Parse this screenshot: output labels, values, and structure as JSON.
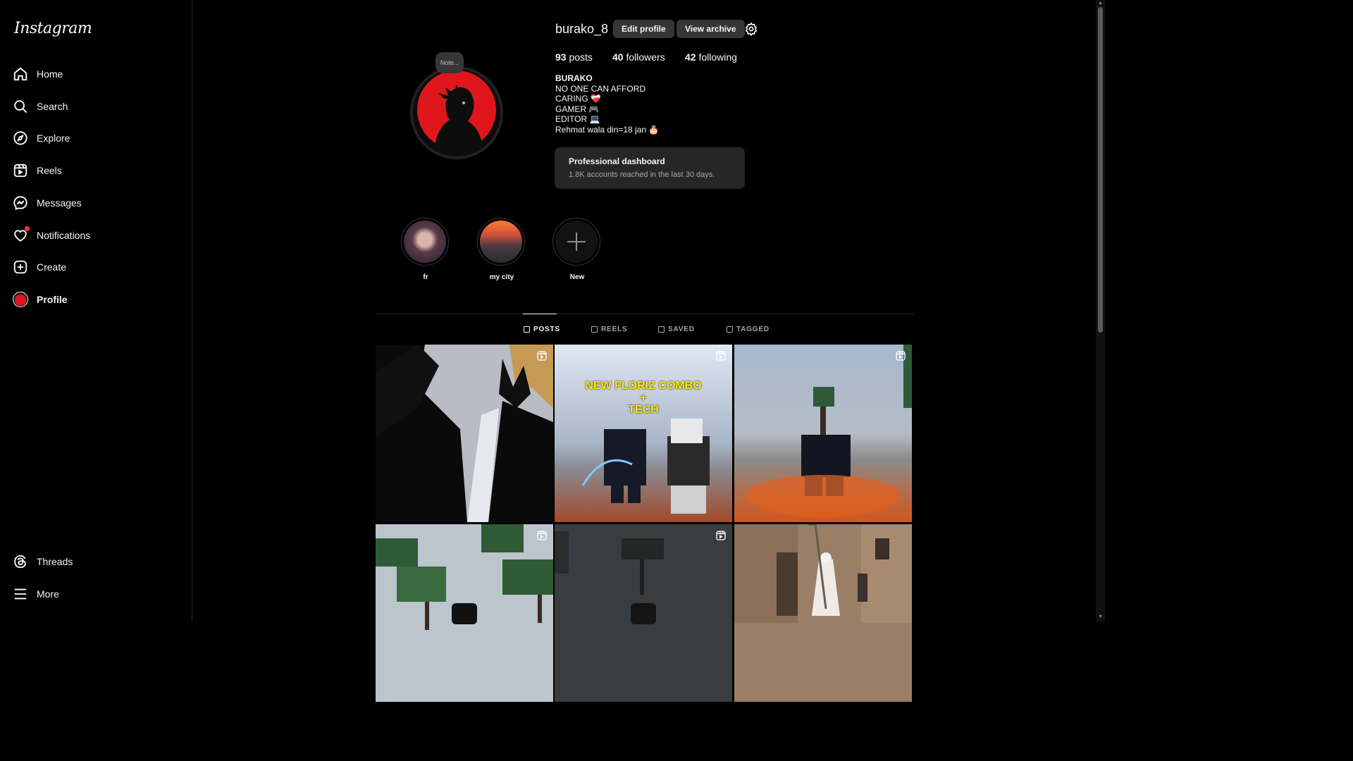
{
  "brand": {
    "logo_text": "Instagram"
  },
  "nav": {
    "items": [
      {
        "label": "Home",
        "icon": "home-icon"
      },
      {
        "label": "Search",
        "icon": "search-icon"
      },
      {
        "label": "Explore",
        "icon": "compass-icon"
      },
      {
        "label": "Reels",
        "icon": "reels-icon"
      },
      {
        "label": "Messages",
        "icon": "messenger-icon"
      },
      {
        "label": "Notifications",
        "icon": "heart-icon"
      },
      {
        "label": "Create",
        "icon": "plus-square-icon"
      },
      {
        "label": "Profile",
        "icon": "avatar"
      }
    ],
    "bottom": [
      {
        "label": "Threads",
        "icon": "threads-icon"
      },
      {
        "label": "More",
        "icon": "menu-icon"
      }
    ]
  },
  "profile": {
    "note": "Note...",
    "username": "burako_8",
    "edit_label": "Edit profile",
    "archive_label": "View archive",
    "stats": {
      "posts_count": "93",
      "posts_label": "posts",
      "followers_count": "40",
      "followers_label": "followers",
      "following_count": "42",
      "following_label": "following"
    },
    "bio": {
      "name": "BURAKO",
      "lines": "NO ONE CAN AFFORD\nCARING ❤️‍🩹\nGAMER 🎮\nEDITOR 💻\nRehmat wala din=18 jan 🎂"
    },
    "dashboard": {
      "title": "Professional dashboard",
      "subtitle": "1.8K accounts reached in the last 30 days."
    }
  },
  "highlights": [
    {
      "label": "fr"
    },
    {
      "label": "my city"
    },
    {
      "label": "New"
    }
  ],
  "tabs": [
    {
      "label": "POSTS",
      "active": true
    },
    {
      "label": "REELS",
      "active": false
    },
    {
      "label": "SAVED",
      "active": false
    },
    {
      "label": "TAGGED",
      "active": false
    }
  ],
  "posts": [
    {
      "caption": ""
    },
    {
      "caption": "NEW FLORIZ COMBO\n+\nTECH"
    },
    {
      "caption": ""
    },
    {
      "caption": ""
    },
    {
      "caption": ""
    },
    {
      "caption": ""
    }
  ],
  "colors": {
    "background": "#000000",
    "panel": "#262626",
    "button": "#363636",
    "accent_red": "#e0161d",
    "notification_dot": "#ff3040"
  }
}
